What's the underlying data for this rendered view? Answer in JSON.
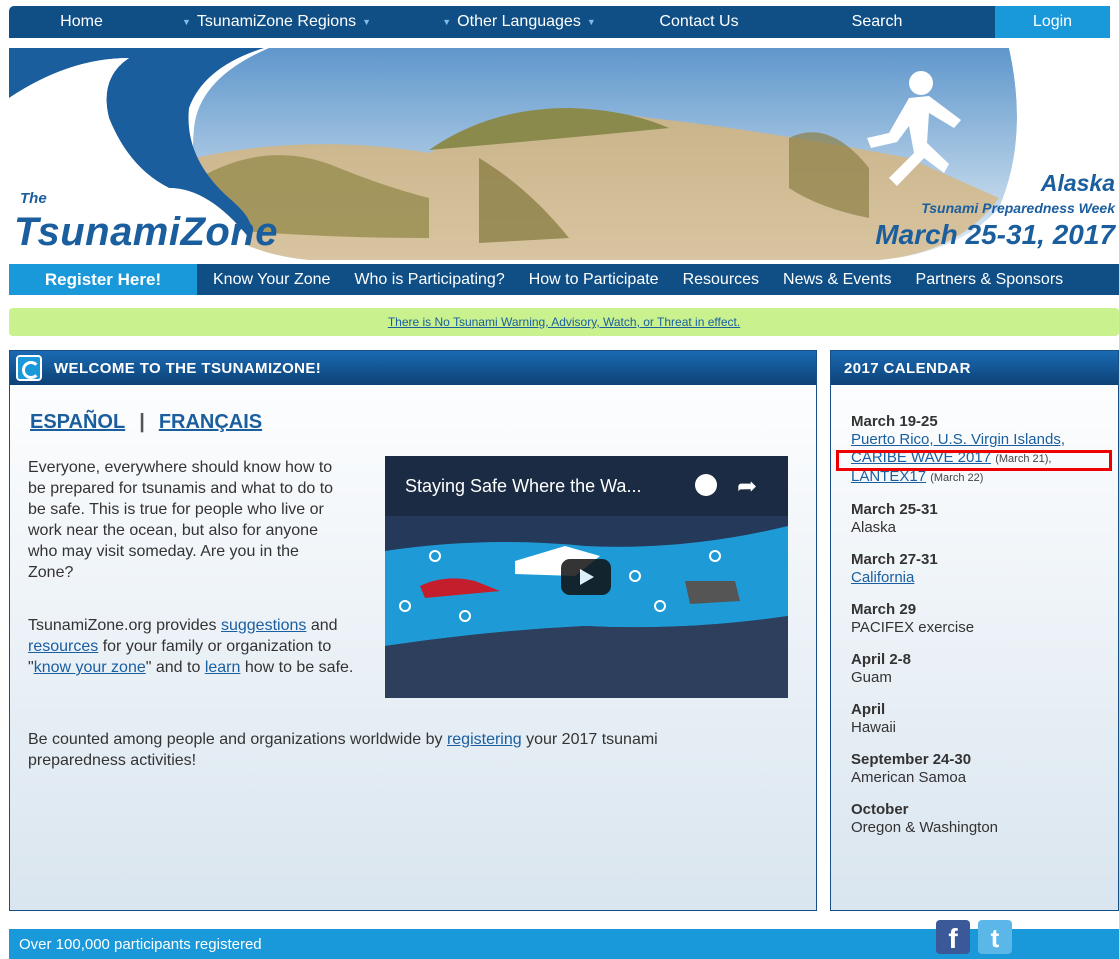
{
  "topnav": {
    "items": [
      "Home",
      "TsunamiZone Regions",
      "Other Languages",
      "Contact Us",
      "Search"
    ],
    "login": "Login"
  },
  "header": {
    "the": "The",
    "brand": "TsunamiZone",
    "event_region": "Alaska",
    "event_name": "Tsunami Preparedness Week",
    "event_dates": "March 25-31, 2017"
  },
  "subnav": {
    "register": "Register Here!",
    "items": [
      "Know Your Zone",
      "Who is Participating?",
      "How to Participate",
      "Resources",
      "News & Events",
      "Partners & Sponsors"
    ]
  },
  "alert": {
    "text": "There is No Tsunami Warning, Advisory, Watch, or Threat in effect."
  },
  "welcome": {
    "title": "WELCOME TO THE TSUNAMIZONE!",
    "lang_es": "ESPAÑOL",
    "lang_sep": "|",
    "lang_fr": "FRANÇAIS",
    "para1": "Everyone, everywhere should know how to be prepared for tsunamis and what to do to be safe. This is true for people who live or work near the ocean, but also for anyone who may visit someday. Are you in the Zone?",
    "para2_a": "TsunamiZone.org provides ",
    "para2_link1": "suggestions",
    "para2_b": " and ",
    "para2_link2": "resources",
    "para2_c": " for your family or organization to \"",
    "para2_link3": "know your zone",
    "para2_d": "\" and to ",
    "para2_link4": "learn",
    "para2_e": " how to be safe.",
    "para3_a": "Be counted among people and organizations worldwide by ",
    "para3_link": "registering",
    "para3_b": " your 2017 tsunami preparedness activities!"
  },
  "video": {
    "title": "Staying Safe Where the Wa..."
  },
  "calendar": {
    "title": "2017 CALENDAR",
    "e1_date": "March 19-25",
    "e1_link1": "Puerto Rico, U.S. Virgin Islands,",
    "e1_link2": "CARIBE WAVE 2017",
    "e1_small2": "(March 21),",
    "e1_link3": "LANTEX17",
    "e1_small3": "(March 22)",
    "e2_date": "March 25-31",
    "e2_text": "Alaska",
    "e3_date": "March 27-31",
    "e3_link": "California",
    "e4_date": "March 29",
    "e4_text": "PACIFEX exercise",
    "e5_date": "April 2-8",
    "e5_text": "Guam",
    "e6_date": "April",
    "e6_text": "Hawaii",
    "e7_date": "September 24-30",
    "e7_text": "American Samoa",
    "e8_date": "October",
    "e8_text": "Oregon & Washington"
  },
  "footer": {
    "text": "Over 100,000 participants registered",
    "fb": "f",
    "tw": "t"
  }
}
